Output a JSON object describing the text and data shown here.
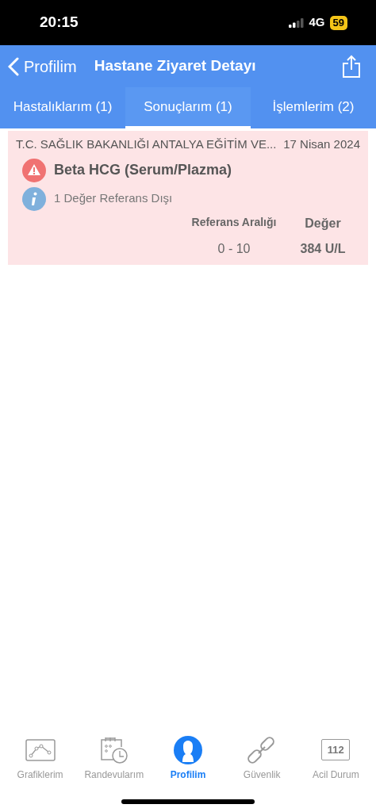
{
  "status_bar": {
    "time": "20:15",
    "network": "4G",
    "battery": "59"
  },
  "nav": {
    "back": "Profilim",
    "title": "Hastane Ziyaret Detayı"
  },
  "tabs": [
    {
      "label": "Hastalıklarım (1)",
      "selected": false
    },
    {
      "label": "Sonuçlarım (1)",
      "selected": true
    },
    {
      "label": "İşlemlerim (2)",
      "selected": false
    }
  ],
  "results": [
    {
      "hospital": "T.C. SAĞLIK BAKANLIĞI ANTALYA EĞİTİM VE...",
      "date": "17 Nisan 2024",
      "test": "Beta HCG (Serum/Plazma)",
      "note": "1 Değer Referans Dışı",
      "columns": [
        "Referans Aralığı",
        "Değer"
      ],
      "range": "0 - 10",
      "value": "384 U/L"
    }
  ],
  "tab_bar": [
    {
      "kind": "chart",
      "label": "Grafiklerim",
      "selected": false
    },
    {
      "kind": "calendar",
      "label": "Randevularım",
      "selected": false
    },
    {
      "kind": "profile",
      "label": "Profilim",
      "selected": true
    },
    {
      "kind": "link",
      "label": "Güvenlik",
      "selected": false
    },
    {
      "kind": "emergency",
      "label": "Acil Durum",
      "icon_text": "112",
      "selected": false
    }
  ]
}
